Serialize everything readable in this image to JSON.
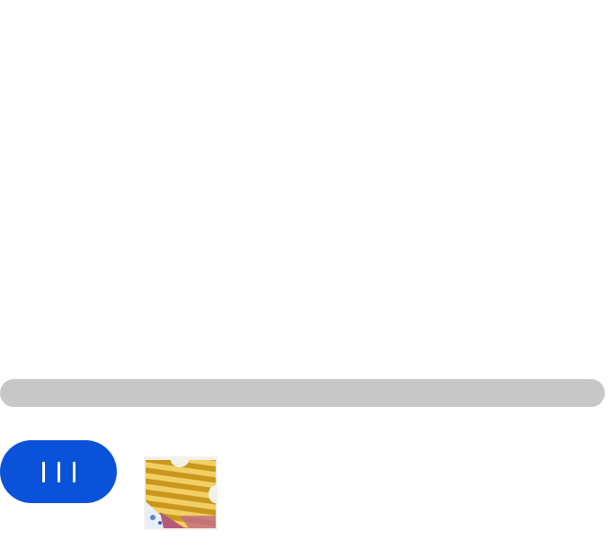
{
  "menu_button": {
    "icon": "three-vertical-bars-icon",
    "color": "#0a52d9",
    "icon_color": "#ffffff"
  },
  "scrollbar": {
    "color": "#c7c7c7"
  },
  "thumbnail": {
    "icon": "puzzle-piece-thumbnail",
    "colors": {
      "stripe_dark": "#c9961e",
      "stripe_light": "#f2cf63",
      "accent_pink": "#b55a7a",
      "accent_blue": "#5b86c9"
    }
  }
}
